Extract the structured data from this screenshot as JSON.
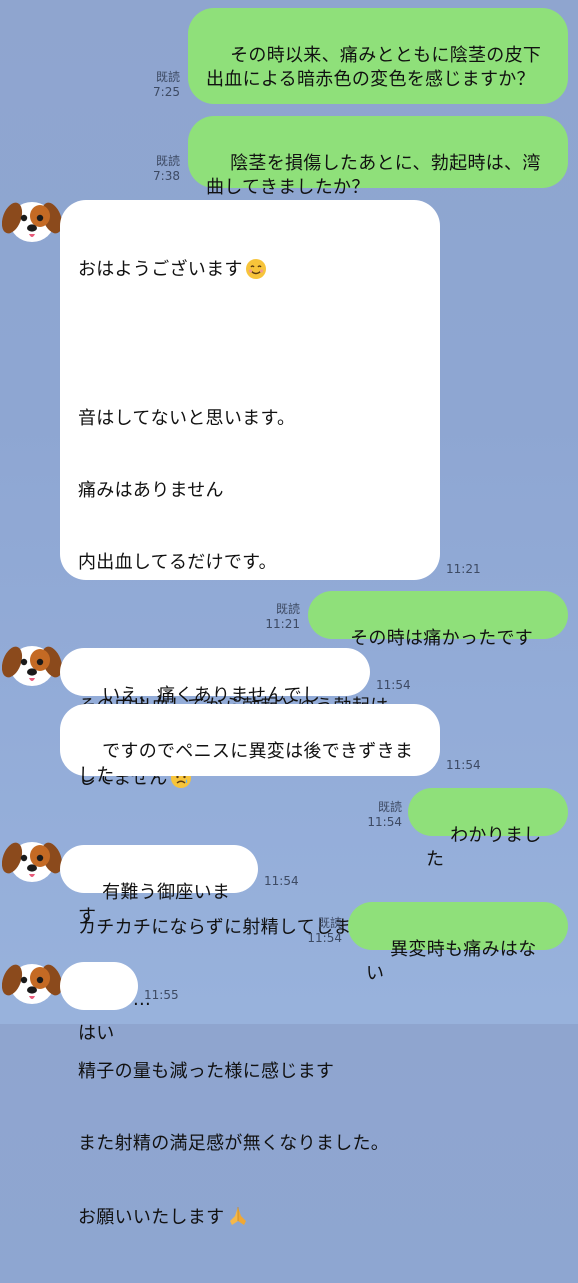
{
  "messages": [
    {
      "id": "m1",
      "side": "out",
      "text": "その時以来、痛みとともに陰茎の皮下出血による暗赤色の変色を感じますか？",
      "read_label": "既読",
      "time": "7:25"
    },
    {
      "id": "m2",
      "side": "out",
      "text": "陰茎を損傷したあとに、勃起時は、湾曲してきましたか？",
      "read_label": "既読",
      "time": "7:38"
    },
    {
      "id": "m3",
      "side": "in",
      "text_lines": [
        "おはようございます",
        "",
        "音はしてないと思います。",
        "痛みはありません",
        "内出血してるだけです。",
        "",
        "その内出血してから勃起とゆう勃起は",
        "してません",
        "",
        "カチカチにならずに射精してしまう感",
        "じです…",
        "精子の量も減った様に感じます",
        "また射精の満足感が無くなりました。",
        "お願いいたします"
      ],
      "time": "11:21",
      "emoji_smile": "smiling-face-emoji",
      "emoji_sad": "sad-face-emoji",
      "emoji_pray": "praying-hands-emoji"
    },
    {
      "id": "m4",
      "side": "out",
      "text": "その時は痛かったですか",
      "read_label": "既読",
      "time": "11:21"
    },
    {
      "id": "m5",
      "side": "in",
      "text": "いえ、痛くありませんでした。",
      "time": "11:54"
    },
    {
      "id": "m6",
      "side": "in",
      "text": "ですのでペニスに異変は後できずきました",
      "time": "11:54"
    },
    {
      "id": "m7",
      "side": "out",
      "text": "わかりました",
      "read_label": "既読",
      "time": "11:54"
    },
    {
      "id": "m8",
      "side": "in",
      "text": "有難う御座います",
      "time": "11:54"
    },
    {
      "id": "m9",
      "side": "out",
      "text": "異変時も痛みはない",
      "read_label": "既読",
      "time": "11:54"
    },
    {
      "id": "m10",
      "side": "in",
      "text": "はい",
      "time": "11:55"
    }
  ],
  "colors": {
    "outgoing_bubble": "#8fe07a",
    "incoming_bubble": "#ffffff",
    "background": "#8fa5cf",
    "meta_text": "#3d4a63"
  },
  "icons": {
    "avatar": "dog-face-avatar"
  }
}
